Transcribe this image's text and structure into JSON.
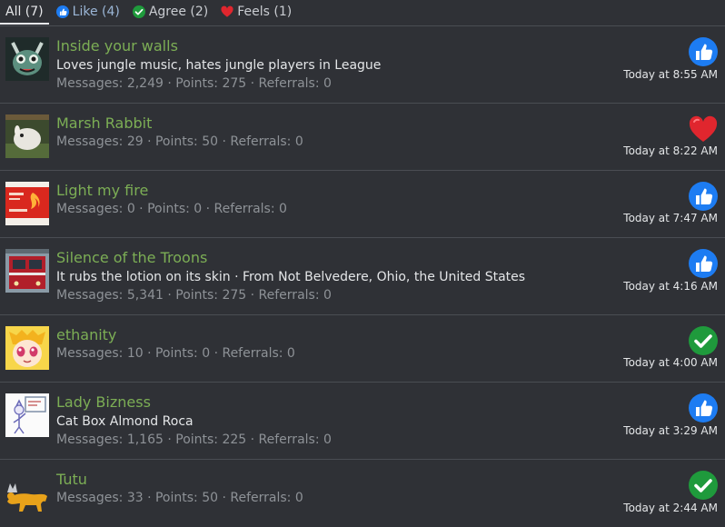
{
  "tabs": [
    {
      "label": "All (7)",
      "icon": ""
    },
    {
      "label": "Like (4)",
      "icon": "like-icon"
    },
    {
      "label": "Agree (2)",
      "icon": "agree-icon"
    },
    {
      "label": "Feels (1)",
      "icon": "feels-icon"
    }
  ],
  "colors": {
    "like": "#1d7cf2",
    "agree": "#1f9a3c",
    "feels": "#e0262e",
    "name": "#7cae55"
  },
  "members": [
    {
      "name": "Inside your walls",
      "desc": "Loves jungle music, hates jungle players in League",
      "stats": "Messages: 2,249 · Points: 275 · Referrals: 0",
      "time": "Today at 8:55 AM",
      "reaction": "like-icon"
    },
    {
      "name": "Marsh Rabbit",
      "desc": "",
      "stats": "Messages: 29 · Points: 50 · Referrals: 0",
      "time": "Today at 8:22 AM",
      "reaction": "feels-icon"
    },
    {
      "name": "Light my fire",
      "desc": "",
      "stats": "Messages: 0 · Points: 0 · Referrals: 0",
      "time": "Today at 7:47 AM",
      "reaction": "like-icon"
    },
    {
      "name": "Silence of the Troons",
      "desc": "It rubs the lotion on its skin · From Not Belvedere, Ohio, the United States",
      "stats": "Messages: 5,341 · Points: 275 · Referrals: 0",
      "time": "Today at 4:16 AM",
      "reaction": "like-icon"
    },
    {
      "name": "ethanity",
      "desc": "",
      "stats": "Messages: 10 · Points: 0 · Referrals: 0",
      "time": "Today at 4:00 AM",
      "reaction": "agree-icon"
    },
    {
      "name": "Lady Bizness",
      "desc": "Cat Box Almond Roca",
      "stats": "Messages: 1,165 · Points: 225 · Referrals: 0",
      "time": "Today at 3:29 AM",
      "reaction": "like-icon"
    },
    {
      "name": "Tutu",
      "desc": "",
      "stats": "Messages: 33 · Points: 50 · Referrals: 0",
      "time": "Today at 2:44 AM",
      "reaction": "agree-icon"
    }
  ]
}
